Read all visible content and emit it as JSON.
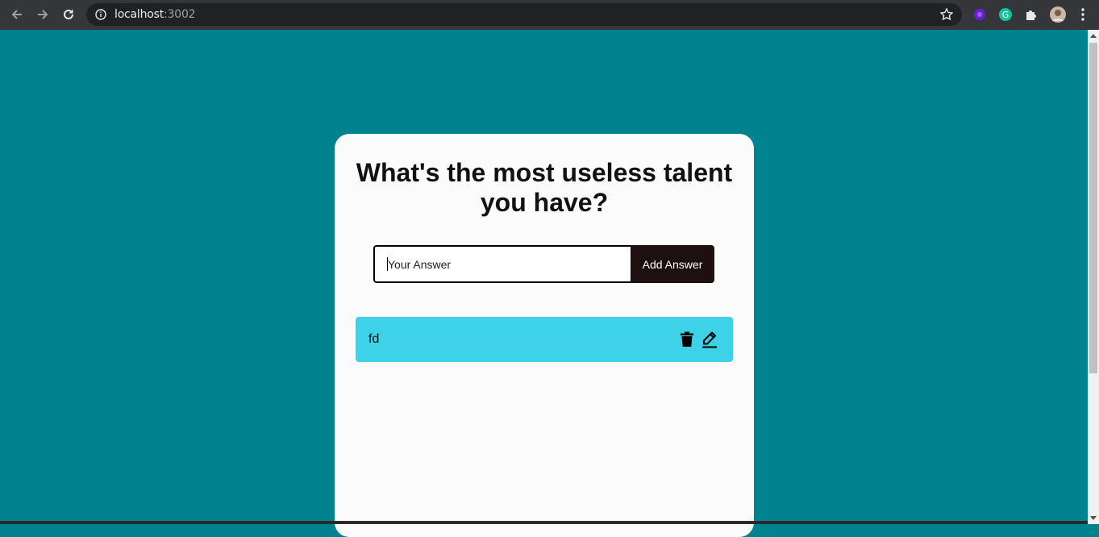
{
  "browser": {
    "url_host": "localhost",
    "url_port": ":3002",
    "icons": {
      "back": "arrow-left-icon",
      "forward": "arrow-right-icon",
      "reload": "reload-icon",
      "info": "info-icon",
      "bookmark": "star-icon",
      "extensions": [
        "purple-extension-icon",
        "grammarly-icon",
        "puzzle-icon",
        "profile-avatar"
      ],
      "menu": "kebab-menu-icon"
    }
  },
  "page": {
    "background_color": "#00838f",
    "question": "What's the most useless talent you have?",
    "input": {
      "value": "",
      "placeholder": "Your Answer"
    },
    "add_button_label": "Add Answer",
    "answers": [
      {
        "text": "fd",
        "color": "#3ed2e9",
        "icons": [
          "trash-icon",
          "edit-icon"
        ]
      }
    ]
  }
}
